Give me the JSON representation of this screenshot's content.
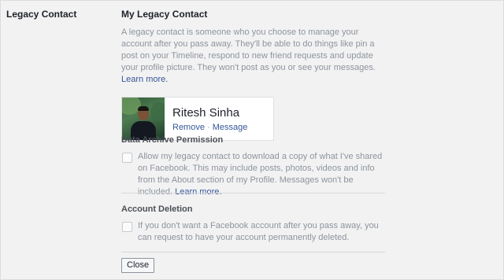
{
  "left_label": "Legacy Contact",
  "legacy": {
    "title": "My Legacy Contact",
    "description": "A legacy contact is someone who you choose to manage your account after you pass away. They'll be able to do things like pin a post on your Timeline, respond to new friend requests and update your profile picture. They won't post as you or see your messages.",
    "learn_more": "Learn more."
  },
  "contact": {
    "name": "Ritesh Sinha",
    "remove_label": "Remove",
    "separator": "·",
    "message_label": "Message"
  },
  "data_archive": {
    "title": "Data Archive Permission",
    "text": "Allow my legacy contact to download a copy of what I've shared on Facebook. This may include posts, photos, videos and info from the About section of my Profile. Messages won't be included.",
    "learn_more": "Learn more.",
    "checked": false
  },
  "account_deletion": {
    "title": "Account Deletion",
    "text": "If you don't want a Facebook account after you pass away, you can request to have your account permanently deleted.",
    "checked": false
  },
  "close_label": "Close"
}
